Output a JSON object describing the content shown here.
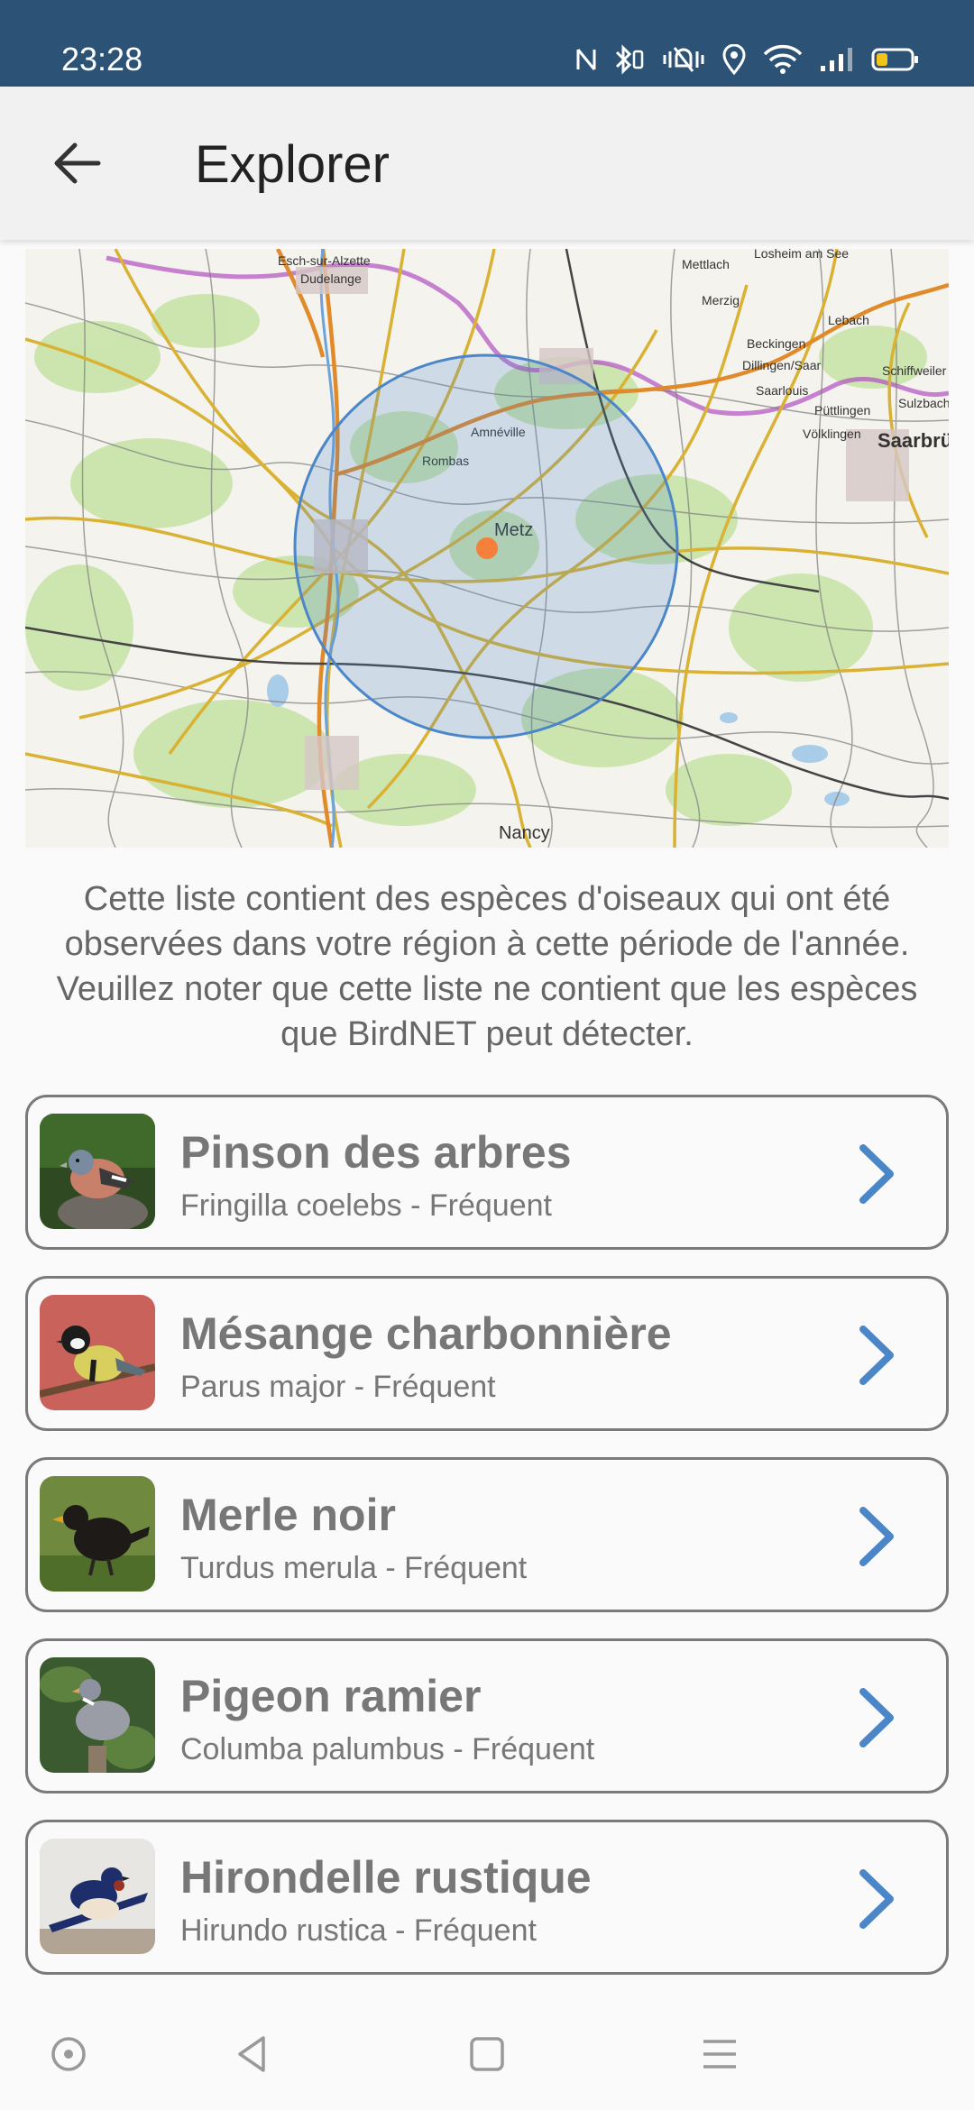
{
  "status_bar": {
    "time": "23:28",
    "icons": [
      "nfc-icon",
      "bluetooth-icon",
      "vibrate-icon",
      "location-icon",
      "wifi-icon",
      "signal-icon",
      "battery-icon"
    ],
    "battery_color": "#f2c318"
  },
  "app_bar": {
    "title": "Explorer",
    "back_icon": "arrow-left-icon"
  },
  "map": {
    "labels": {
      "esch": "Esch-sur-Alzette",
      "dudelange": "Dudelange",
      "mettlach": "Mettlach",
      "losheim": "Losheim am See",
      "merzig": "Merzig",
      "lebach": "Lebach",
      "beckingen": "Beckingen",
      "dillingen": "Dillingen/Saar",
      "schiffweiler": "Schiffweiler",
      "saarlouis": "Saarlouis",
      "puttlingen": "Püttlingen",
      "sulzbach": "Sulzbach",
      "voelklingen": "Völklingen",
      "saarbrucken": "Saarbrüc",
      "amneville": "Amnéville",
      "rombas": "Rombas",
      "metz": "Metz",
      "nancy": "Nancy"
    },
    "marker_color": "#f4803b",
    "radius_color": "#4a86c8"
  },
  "intro_text": "Cette liste contient des espèces d'oiseaux qui ont été observées dans votre région à cette période de l'année. Veuillez noter que cette liste ne contient que les espèces que BirdNET peut détecter.",
  "species": [
    {
      "common": "Pinson des arbres",
      "scientific": "Fringilla coelebs - Fréquent"
    },
    {
      "common": "Mésange charbonnière",
      "scientific": "Parus major - Fréquent"
    },
    {
      "common": "Merle noir",
      "scientific": "Turdus merula - Fréquent"
    },
    {
      "common": "Pigeon ramier",
      "scientific": "Columba palumbus - Fréquent"
    },
    {
      "common": "Hirondelle rustique",
      "scientific": "Hirundo rustica - Fréquent"
    }
  ],
  "accent_color": "#4a86c8",
  "nav_bar": {
    "icons": [
      "assistive-dot-icon",
      "back-triangle-icon",
      "home-square-icon",
      "menu-lines-icon"
    ]
  }
}
